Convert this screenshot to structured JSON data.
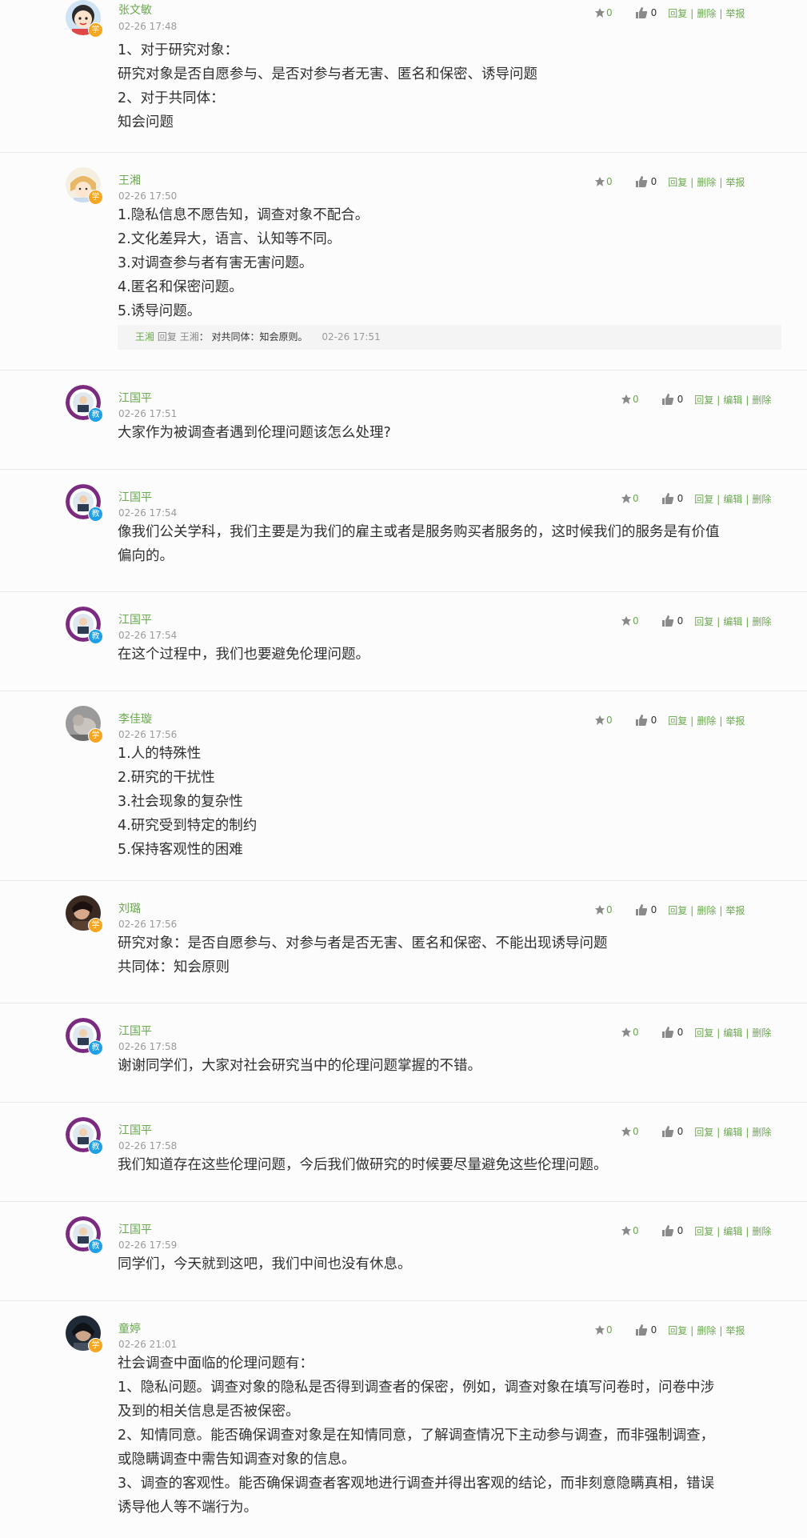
{
  "labels": {
    "reply": "回复",
    "delete": "删除",
    "report": "举报",
    "edit": "编辑",
    "badge_student": "学",
    "badge_teacher": "教"
  },
  "posts": [
    {
      "user": "张文敏",
      "time": "02-26 17:48",
      "flowers": "0",
      "likes": "0",
      "lines": [
        "1、对于研究对象：",
        "研究对象是否自愿参与、是否对参与者无害、匿名和保密、诱导问题",
        "2、对于共同体：",
        "知会问题"
      ]
    },
    {
      "user": "王湘",
      "time": "02-26 17:50",
      "flowers": "0",
      "likes": "0",
      "lines": [
        "1.隐私信息不愿告知，调查对象不配合。",
        "2.文化差异大，语言、认知等不同。",
        "3.对调查参与者有害无害问题。",
        "4.匿名和保密问题。",
        "5.诱导问题。"
      ],
      "reply": {
        "from": "王湘",
        "verb": "回复",
        "to": "王湘",
        "colon": "：",
        "text": "对共同体：知会原则。",
        "time": "02-26 17:51"
      }
    },
    {
      "user": "江国平",
      "time": "02-26 17:51",
      "flowers": "0",
      "likes": "0",
      "lines": [
        "大家作为被调查者遇到伦理问题该怎么处理?"
      ]
    },
    {
      "user": "江国平",
      "time": "02-26 17:54",
      "flowers": "0",
      "likes": "0",
      "lines": [
        "像我们公关学科，我们主要是为我们的雇主或者是服务购买者服务的，这时候我们的服务是有价值",
        "偏向的。"
      ]
    },
    {
      "user": "江国平",
      "time": "02-26 17:54",
      "flowers": "0",
      "likes": "0",
      "lines": [
        "在这个过程中，我们也要避免伦理问题。"
      ]
    },
    {
      "user": "李佳璇",
      "time": "02-26 17:56",
      "flowers": "0",
      "likes": "0",
      "lines": [
        "1.人的特殊性",
        "2.研究的干扰性",
        "3.社会现象的复杂性",
        "4.研究受到特定的制约",
        "5.保持客观性的困难"
      ]
    },
    {
      "user": "刘璐",
      "time": "02-26 17:56",
      "flowers": "0",
      "likes": "0",
      "lines": [
        "研究对象：是否自愿参与、对参与者是否无害、匿名和保密、不能出现诱导问题",
        "共同体：知会原则"
      ]
    },
    {
      "user": "江国平",
      "time": "02-26 17:58",
      "flowers": "0",
      "likes": "0",
      "lines": [
        "谢谢同学们，大家对社会研究当中的伦理问题掌握的不错。"
      ]
    },
    {
      "user": "江国平",
      "time": "02-26 17:58",
      "flowers": "0",
      "likes": "0",
      "lines": [
        "我们知道存在这些伦理问题，今后我们做研究的时候要尽量避免这些伦理问题。"
      ]
    },
    {
      "user": "江国平",
      "time": "02-26 17:59",
      "flowers": "0",
      "likes": "0",
      "lines": [
        "同学们，今天就到这吧，我们中间也没有休息。"
      ]
    },
    {
      "user": "童婷",
      "time": "02-26 21:01",
      "flowers": "0",
      "likes": "0",
      "lines": [
        "社会调查中面临的伦理问题有：",
        "1、隐私问题。调查对象的隐私是否得到调查者的保密，例如，调查对象在填写问卷时，问卷中涉",
        "及到的相关信息是否被保密。",
        "2、知情同意。能否确保调查对象是在知情同意，了解调查情况下主动参与调查，而非强制调查，",
        "或隐瞒调查中需告知调查对象的信息。",
        "3、调查的客观性。能否确保调查者客观地进行调查并得出客观的结论，而非刻意隐瞒真相，错误",
        "诱导他人等不端行为。"
      ]
    }
  ]
}
